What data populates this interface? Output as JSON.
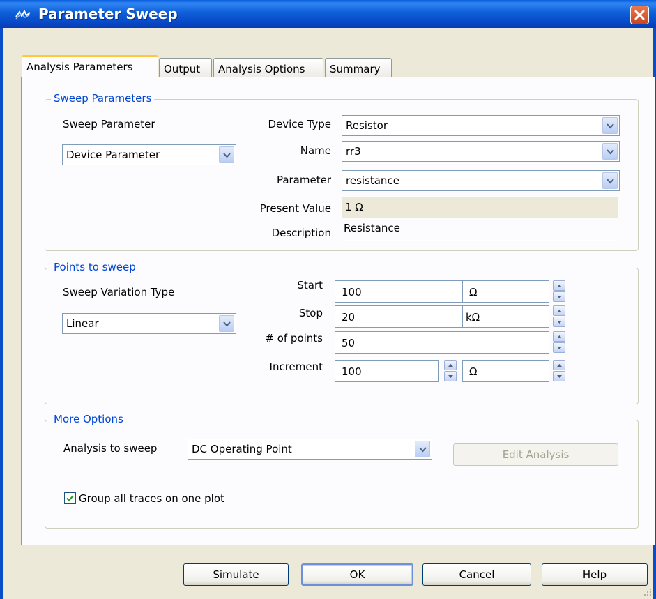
{
  "window": {
    "title": "Parameter Sweep"
  },
  "tabs": [
    {
      "label": "Analysis Parameters"
    },
    {
      "label": "Output"
    },
    {
      "label": "Analysis Options"
    },
    {
      "label": "Summary"
    }
  ],
  "sweep_parameters": {
    "title": "Sweep Parameters",
    "sweep_parameter_label": "Sweep Parameter",
    "sweep_parameter_value": "Device Parameter",
    "device_type_label": "Device Type",
    "device_type_value": "Resistor",
    "name_label": "Name",
    "name_value": "rr3",
    "parameter_label": "Parameter",
    "parameter_value": "resistance",
    "present_value_label": "Present Value",
    "present_value": "1 Ω",
    "description_label": "Description",
    "description_value": "Resistance"
  },
  "points": {
    "title": "Points to sweep",
    "variation_type_label": "Sweep Variation Type",
    "variation_type_value": "Linear",
    "start_label": "Start",
    "start_value": "100",
    "start_unit": "Ω",
    "stop_label": "Stop",
    "stop_value": "20",
    "stop_unit": "kΩ",
    "num_points_label": "# of points",
    "num_points_value": "50",
    "increment_label": "Increment",
    "increment_value": "100",
    "increment_unit": "Ω"
  },
  "more_options": {
    "title": "More Options",
    "analysis_label": "Analysis to sweep",
    "analysis_value": "DC Operating Point",
    "edit_analysis_label": "Edit Analysis",
    "group_traces_label": "Group all traces on one plot",
    "group_traces_checked": true
  },
  "buttons": {
    "simulate": "Simulate",
    "ok": "OK",
    "cancel": "Cancel",
    "help": "Help"
  },
  "colors": {
    "title_bar": "#0A5EDB",
    "group_title": "#0046D5",
    "close": "#D9582F",
    "tab_highlight": "#FFC83C"
  },
  "icons": [
    "app-icon",
    "close-icon",
    "chevron-down-icon",
    "spin-up-icon",
    "spin-down-icon",
    "checkmark-icon",
    "resize-grip-icon"
  ]
}
